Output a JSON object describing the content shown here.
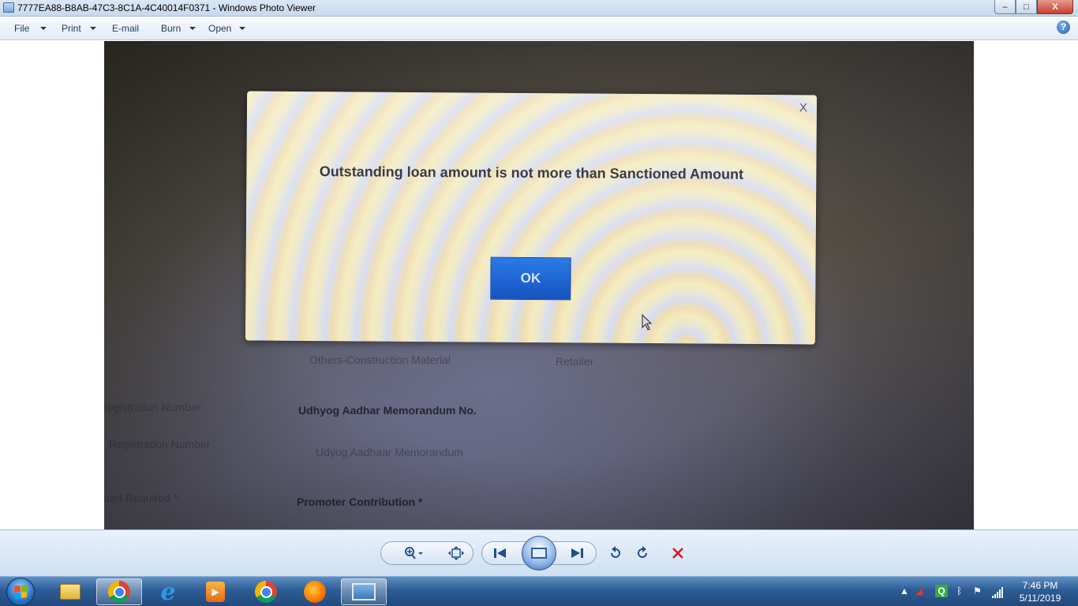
{
  "window": {
    "title": "7777EA88-B8AB-47C3-8C1A-4C40014F0371 - Windows Photo Viewer",
    "buttons": {
      "minimize": "–",
      "maximize": "□",
      "close": "X"
    }
  },
  "menu": {
    "items": [
      {
        "label": "File",
        "has_dropdown": true
      },
      {
        "label": "Print",
        "has_dropdown": true
      },
      {
        "label": "E-mail",
        "has_dropdown": false
      },
      {
        "label": "Burn",
        "has_dropdown": true
      },
      {
        "label": "Open",
        "has_dropdown": true
      }
    ],
    "help_icon": "?"
  },
  "photo": {
    "background_text": {
      "row1_left": "Others-Construction Material",
      "row1_right": "Retailer",
      "row2_left": "Registration Number",
      "row2_right": "Udhyog Aadhar Memorandum No.",
      "row3_left": "Registration Number",
      "row3_right": "Udyog Aadhaar Memorandum",
      "row4_left": "ount Required *",
      "row4_right": "Promoter Contribution *"
    },
    "dialog": {
      "close_label": "X",
      "message": "Outstanding loan amount is not more than Sanctioned Amount",
      "ok_label": "OK"
    }
  },
  "controls": {
    "icons": [
      "zoom-icon",
      "actual-size-icon",
      "previous-icon",
      "slideshow-icon",
      "next-icon",
      "rotate-left-icon",
      "rotate-right-icon",
      "delete-icon"
    ]
  },
  "taskbar": {
    "apps": [
      "windows-explorer",
      "google-chrome",
      "internet-explorer",
      "media-player",
      "chrome-beta",
      "firefox",
      "windows-photo-viewer"
    ],
    "tray": {
      "time": "7:46 PM",
      "date": "5/11/2019",
      "q_label": "Q"
    }
  },
  "colors": {
    "ok_button": "#1f66d8",
    "taskbar": "#2d5c95",
    "titlebar": "#dbe8f6"
  }
}
